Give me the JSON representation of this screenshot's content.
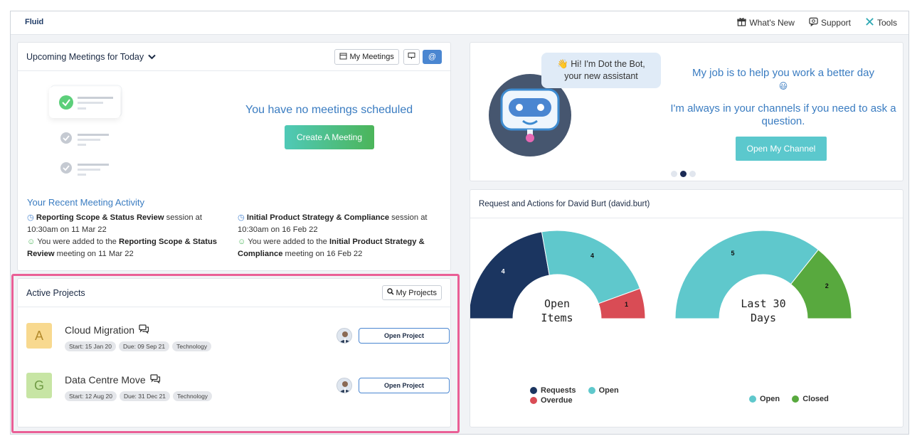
{
  "app": {
    "name": "Fluid"
  },
  "topnav": {
    "whats_new": "What's New",
    "support": "Support",
    "tools": "Tools"
  },
  "meetings": {
    "title": "Upcoming Meetings for Today",
    "my_meetings": "My Meetings",
    "empty_message": "You have no meetings scheduled",
    "create_button": "Create A Meeting",
    "at_button": "@"
  },
  "recent": {
    "title": "Your Recent Meeting Activity",
    "items": [
      {
        "bold": "Reporting Scope & Status Review",
        "text": " session at 10:30am on 11 Mar 22"
      },
      {
        "bold": "Initial Product Strategy & Compliance",
        "text": " session at 10:30am on 16 Feb 22"
      },
      {
        "pre": "You were added to the ",
        "bold": "Reporting Scope & Status Review",
        "text": " meeting on 11 Mar 22"
      },
      {
        "pre": "You were added to the ",
        "bold": "Initial Product Strategy & Compliance",
        "text": " meeting on 16 Feb 22"
      }
    ]
  },
  "projects": {
    "title": "Active Projects",
    "my_projects": "My Projects",
    "items": [
      {
        "letter": "A",
        "name": "Cloud Migration",
        "start": "Start: 15 Jan 20",
        "due": "Due: 09 Sep 21",
        "category": "Technology",
        "open": "Open Project",
        "color": "#f8d98f",
        "text_color": "#b38a2b"
      },
      {
        "letter": "G",
        "name": "Data Centre Move",
        "start": "Start: 12 Aug 20",
        "due": "Due: 31 Dec 21",
        "category": "Technology",
        "open": "Open Project",
        "color": "#c7e5a4",
        "text_color": "#6f9a44"
      }
    ]
  },
  "bot": {
    "bubble_line1": "Hi! I'm Dot the Bot,",
    "bubble_line2": "your new assistant",
    "message1": "My job is to help you work a better day",
    "emoji": "😃",
    "message2": "I'm always in your channels if you need to ask a question.",
    "channel_button": "Open My Channel"
  },
  "requests": {
    "title": "Request and Actions for David Burt (david.burt)"
  },
  "chart_data": [
    {
      "type": "pie",
      "title": "Open Items",
      "center_label_line1": "Open",
      "center_label_line2": "Items",
      "categories": [
        "Requests",
        "Open",
        "Overdue"
      ],
      "values": [
        4,
        4,
        1
      ],
      "colors": [
        "#1b3560",
        "#5fc8cc",
        "#d94c55"
      ]
    },
    {
      "type": "pie",
      "title": "Last 30 Days",
      "center_label_line1": "Last 30",
      "center_label_line2": "Days",
      "categories": [
        "Open",
        "Closed"
      ],
      "values": [
        5,
        2
      ],
      "colors": [
        "#5fc8cc",
        "#58a93e"
      ]
    }
  ],
  "colors": {
    "accent": "#3a7cc1",
    "highlight": "#ea5f96"
  }
}
